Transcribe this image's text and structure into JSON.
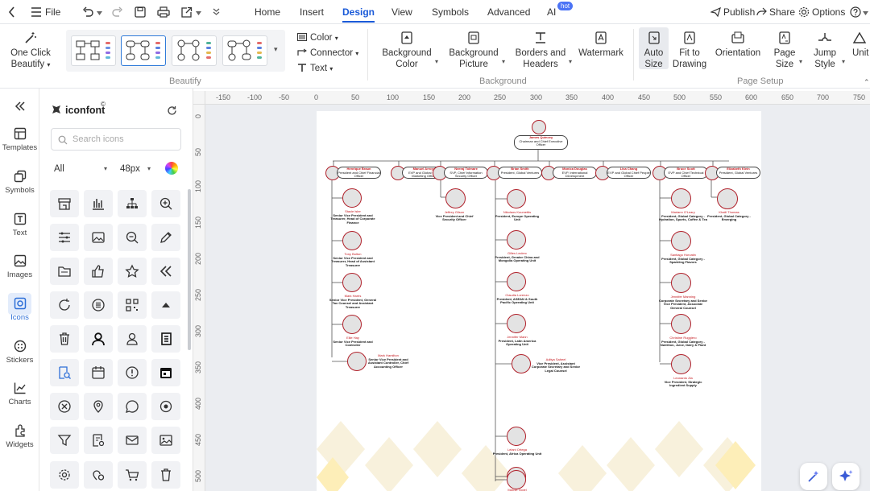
{
  "topbar": {
    "file_label": "File",
    "tabs": [
      "Home",
      "Insert",
      "Design",
      "View",
      "Symbols",
      "Advanced",
      "AI"
    ],
    "active_tab": "Design",
    "ai_badge": "hot",
    "publish": "Publish",
    "share": "Share",
    "options": "Options"
  },
  "ribbon": {
    "one_click": "One Click",
    "beautify": "Beautify",
    "beautify_group": "Beautify",
    "color": "Color",
    "connector": "Connector",
    "text": "Text",
    "bg_color_1": "Background",
    "bg_color_2": "Color",
    "bg_pic_1": "Background",
    "bg_pic_2": "Picture",
    "borders_1": "Borders and",
    "borders_2": "Headers",
    "watermark": "Watermark",
    "background_group": "Background",
    "auto_size_1": "Auto",
    "auto_size_2": "Size",
    "fit_1": "Fit to",
    "fit_2": "Drawing",
    "orientation": "Orientation",
    "page_size_1": "Page",
    "page_size_2": "Size",
    "jump_1": "Jump",
    "jump_2": "Style",
    "unit": "Unit",
    "page_setup_group": "Page Setup"
  },
  "rail": {
    "templates": "Templates",
    "symbols": "Symbols",
    "text": "Text",
    "images": "Images",
    "icons": "Icons",
    "stickers": "Stickers",
    "charts": "Charts",
    "widgets": "Widgets"
  },
  "panel": {
    "title": "iconfont",
    "search_placeholder": "Search icons",
    "filter": "All",
    "size": "48px"
  },
  "rulers": {
    "h": [
      "-150",
      "-100",
      "-50",
      "0",
      "50",
      "100",
      "150",
      "200",
      "250",
      "300",
      "350",
      "400",
      "450",
      "500",
      "550",
      "600",
      "650",
      "700",
      "750"
    ],
    "v": [
      "0",
      "50",
      "100",
      "150",
      "200",
      "250",
      "300",
      "350",
      "400",
      "450",
      "500"
    ]
  },
  "orgchart": {
    "ceo": {
      "name": "James Quincey",
      "title": "Chairman and Chief Executive Officer"
    },
    "level1": [
      {
        "name": "Henrique Braun",
        "title": "President and Chief Financial Officer"
      },
      {
        "name": "Manuel Arroyo",
        "title": "EVP and Global Chief Marketing Officer"
      },
      {
        "name": "Neeraj Tolmare",
        "title": "SVP, Chief Information Security Officer"
      },
      {
        "name": "Brian Smith",
        "title": "President, Global Ventures"
      },
      {
        "name": "Monica Douglas",
        "title": "EVP, International Development"
      },
      {
        "name": "Lisa Chang",
        "title": "EVP and Global Chief People Officer"
      },
      {
        "name": "Bruce Scott",
        "title": "EVP and Chief Technical Officer"
      },
      {
        "name": "Elizabeth Klein",
        "title": "President, Global Ventures"
      }
    ],
    "col1": [
      {
        "name": "Stacie Isler",
        "title": "Senior Vice President and Treasurer, Head of Corporate Finance"
      },
      {
        "name": "Tony Bolton",
        "title": "Senior Vice President and Treasurer, Head of Assistant Treasurer"
      },
      {
        "name": "Mark Harris",
        "title": "Senior Vice President, General Tax Counsel and Assistant Treasurer"
      },
      {
        "name": "Ellie Hay",
        "title": "Senior Vice President and Controller"
      },
      {
        "name": "Mark Hamilton",
        "title": "Senior Vice President and Assistant Controller, Chief Accounting Officer"
      }
    ],
    "col2": [
      {
        "name": "Jeffrey Gilson",
        "title": "Vice President and Chief Security Officer"
      }
    ],
    "col3": [
      {
        "name": "Nikolaos Koumettis",
        "title": "President, Europe Operating Unit"
      },
      {
        "name": "Gilles Leclerc",
        "title": "President, Greater China and Mongolia Operating Unit"
      },
      {
        "name": "Claudia Lorenzo",
        "title": "President, ASEAN & South Pacific Operating Unit"
      },
      {
        "name": "Jennifer Mann",
        "title": "President, Latin America Operating Unit"
      },
      {
        "name": "Aditya Saheel",
        "title": "Vice President, Assistant Corporate Secretary and Senior Legal Counsel"
      },
      {
        "name": "Lelani Ortega",
        "title": "President, Africa Operating Unit"
      },
      {
        "name": "Marnie Vogel",
        "title": "President, Japan & South Korea Operating Unit"
      }
    ],
    "col4": [
      {
        "name": "Mariann O'Leary",
        "title": "President, Global Category - Hydration, Sports, Coffee & Tea"
      },
      {
        "name": "Santiago Horvatin",
        "title": "President, Global Category - Sparkling Flavors"
      },
      {
        "name": "Jennifer Manning",
        "title": "Corporate Secretary and Senior Vice President, Associate General Counsel"
      },
      {
        "name": "Christine Ruggiero",
        "title": "President, Global Category - Nutrition, Juice, Dairy & Plant"
      },
      {
        "name": "Leonardo Zia",
        "title": "Vice President, Strategic Ingredient Supply"
      }
    ],
    "col5": [
      {
        "name": "Khalil Thomas",
        "title": "President, Global Category - Emerging"
      }
    ]
  }
}
